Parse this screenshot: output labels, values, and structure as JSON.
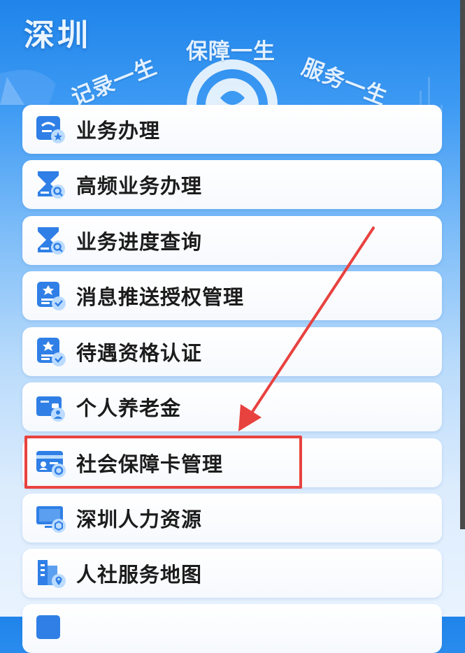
{
  "header": {
    "city": "深圳",
    "slogans": [
      "记录一生",
      "保障一生",
      "服务一生"
    ]
  },
  "menu": {
    "items": [
      {
        "label": "业务办理",
        "icon": "id-card-star-icon"
      },
      {
        "label": "高频业务办理",
        "icon": "hourglass-search-icon"
      },
      {
        "label": "业务进度查询",
        "icon": "hourglass-search-icon"
      },
      {
        "label": "消息推送授权管理",
        "icon": "badge-check-icon"
      },
      {
        "label": "待遇资格认证",
        "icon": "badge-check-icon"
      },
      {
        "label": "个人养老金",
        "icon": "wallet-person-icon"
      },
      {
        "label": "社会保障卡管理",
        "icon": "social-security-card-icon"
      },
      {
        "label": "深圳人力资源",
        "icon": "monitor-cube-icon"
      },
      {
        "label": "人社服务地图",
        "icon": "building-location-icon"
      },
      {
        "label": "",
        "icon": ""
      }
    ]
  },
  "colors": {
    "header_blue": "#1f84ea",
    "icon_blue": "#2f7fe6",
    "icon_light": "#bcdcff",
    "annotation_red": "#e8423f"
  }
}
